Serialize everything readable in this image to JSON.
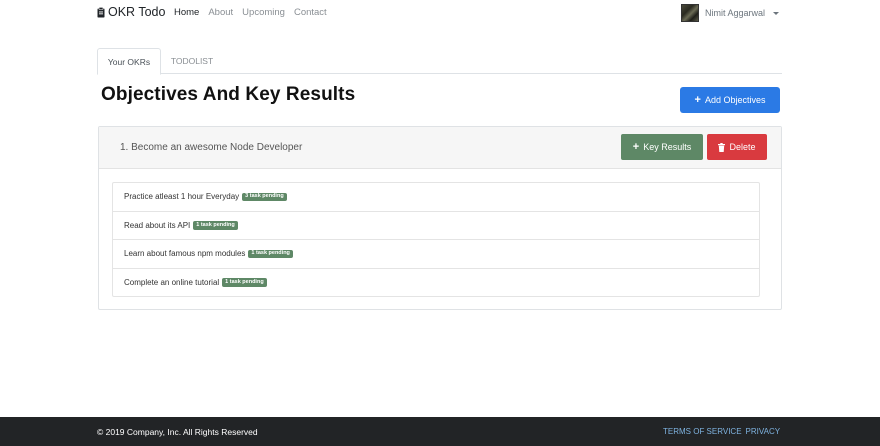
{
  "brand": {
    "label": "OKR Todo",
    "icon": "clipboard-icon"
  },
  "nav": {
    "links": [
      {
        "label": "Home"
      },
      {
        "label": "About"
      },
      {
        "label": "Upcoming"
      },
      {
        "label": "Contact"
      }
    ]
  },
  "user": {
    "name": "Nimit Aggarwal"
  },
  "tabs": [
    {
      "label": "Your OKRs"
    },
    {
      "label": "TODOLIST"
    }
  ],
  "page": {
    "title": "Objectives And Key Results",
    "add_button": {
      "icon": "plus-icon",
      "label": "Add Objectives"
    }
  },
  "objective": {
    "title": "1. Become an awesome Node Developer",
    "key_results_button": {
      "icon": "plus-icon",
      "label": "Key Results"
    },
    "delete_button": {
      "icon": "trash-icon",
      "label": "Delete"
    },
    "key_results": [
      {
        "text": "Practice atleast 1 hour Everyday",
        "badge": "3 task pending"
      },
      {
        "text": "Read about its API",
        "badge": "1 task pending"
      },
      {
        "text": "Learn about famous npm modules",
        "badge": "1 task pending"
      },
      {
        "text": "Complete an online tutorial",
        "badge": "1 task pending"
      }
    ]
  },
  "footer": {
    "copyright": "© 2019 Company, Inc. All Rights Reserved",
    "links": [
      {
        "label": "TERMS OF SERVICE"
      },
      {
        "label": "PRIVACY"
      }
    ]
  },
  "colors": {
    "primary": "#2b7ae5",
    "success_muted": "#5e8866",
    "danger": "#d93a3f",
    "footer_bg": "#222426",
    "footer_link": "#7fb3e0"
  }
}
